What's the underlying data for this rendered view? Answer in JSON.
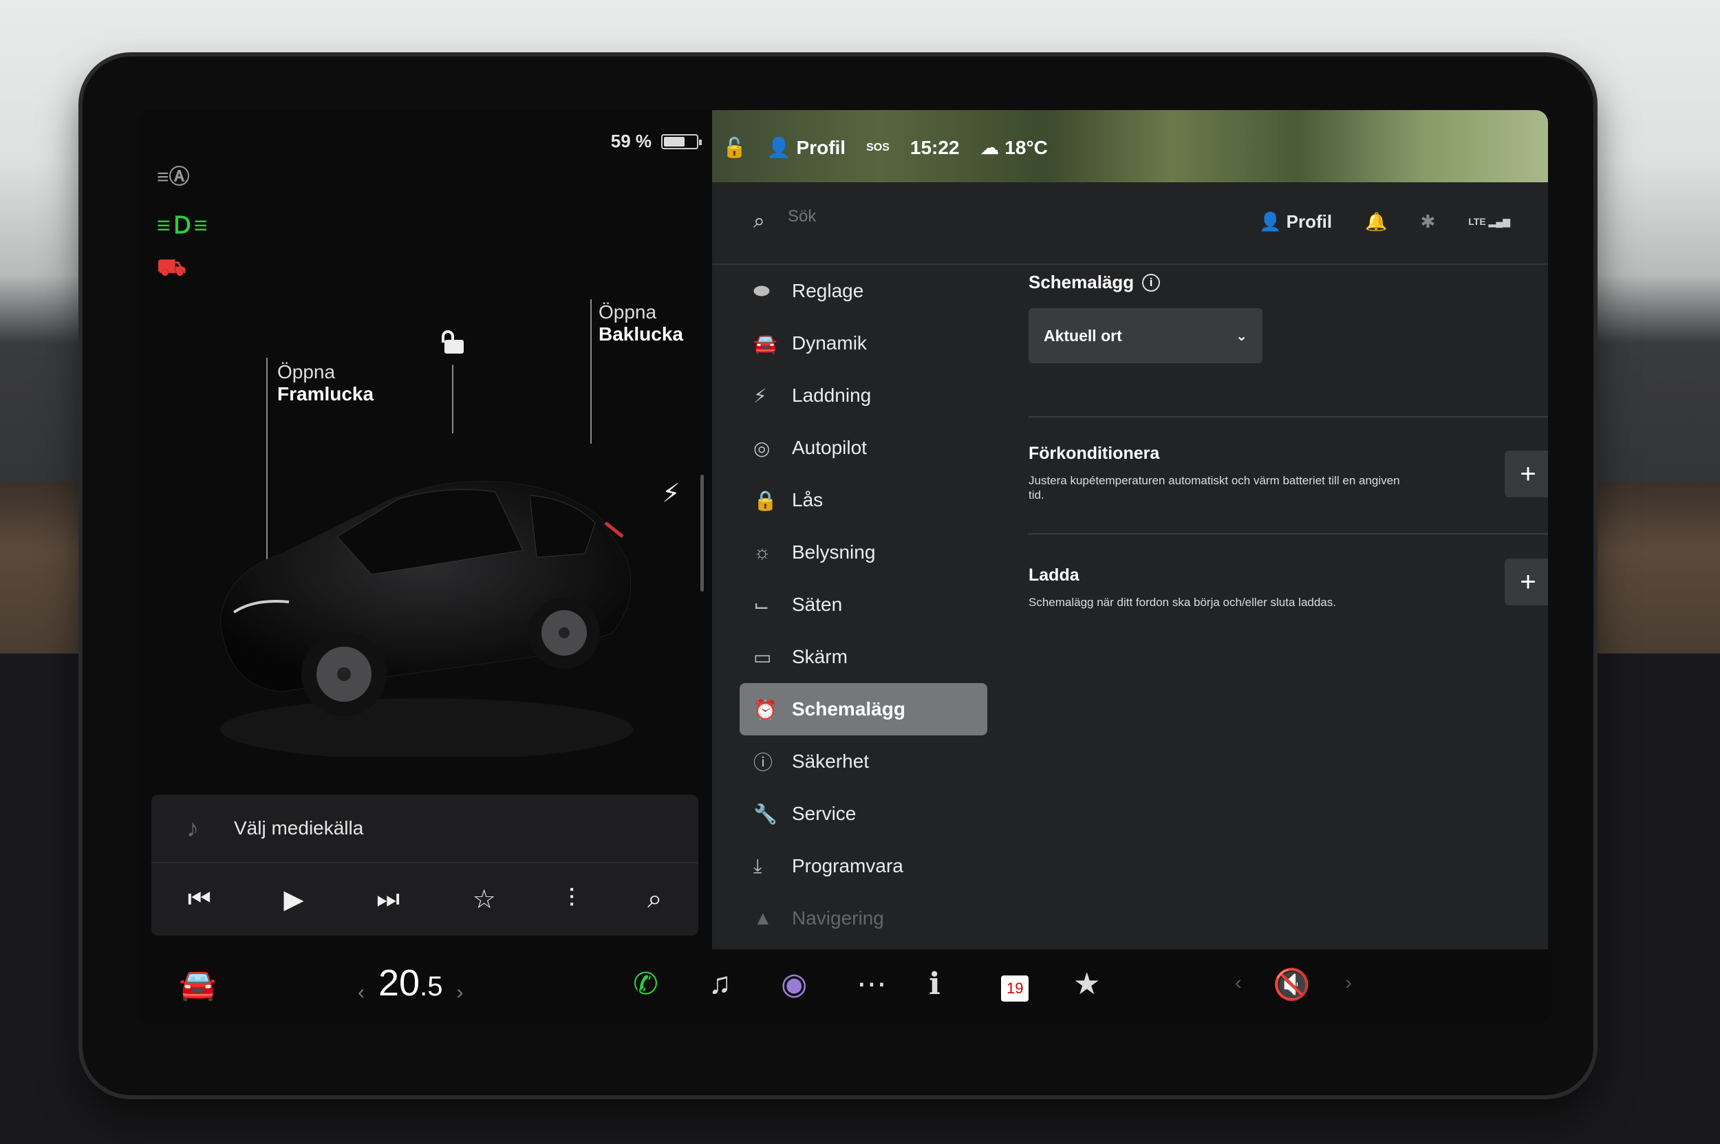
{
  "status": {
    "battery": "59 %",
    "battery_fraction": 0.59,
    "profile": "Profil",
    "sos": "SOS",
    "time": "15:22",
    "weather": "18°C"
  },
  "left_panel": {
    "callout_front_l1": "Öppna",
    "callout_front_l2": "Framlucka",
    "callout_trunk_l1": "Öppna",
    "callout_trunk_l2": "Baklucka"
  },
  "media": {
    "source_label": "Välj mediekälla"
  },
  "search": {
    "placeholder": "Sök"
  },
  "header_right": {
    "profile": "Profil",
    "signal": "LTE"
  },
  "nav": [
    {
      "label": "Reglage",
      "icon": "toggle-icon"
    },
    {
      "label": "Dynamik",
      "icon": "car-icon"
    },
    {
      "label": "Laddning",
      "icon": "bolt-icon"
    },
    {
      "label": "Autopilot",
      "icon": "steering-wheel-icon"
    },
    {
      "label": "Lås",
      "icon": "lock-icon"
    },
    {
      "label": "Belysning",
      "icon": "sun-icon"
    },
    {
      "label": "Säten",
      "icon": "seat-icon"
    },
    {
      "label": "Skärm",
      "icon": "display-icon"
    },
    {
      "label": "Schemalägg",
      "icon": "alarm-clock-icon"
    },
    {
      "label": "Säkerhet",
      "icon": "alert-icon"
    },
    {
      "label": "Service",
      "icon": "wrench-icon"
    },
    {
      "label": "Programvara",
      "icon": "download-icon"
    },
    {
      "label": "Navigering",
      "icon": "navigation-icon"
    }
  ],
  "content": {
    "title": "Schemalägg",
    "dropdown_value": "Aktuell ort",
    "precondition_title": "Förkonditionera",
    "precondition_desc": "Justera kupétemperaturen automatiskt och värm batteriet till en angiven tid.",
    "charge_title": "Ladda",
    "charge_desc": "Schemalägg när ditt fordon ska börja och/eller sluta laddas."
  },
  "bottombar": {
    "temp_int": "20",
    "temp_dec": ".5",
    "calendar_day": "19"
  },
  "colors": {
    "active_nav": "#757779",
    "call_green": "#2ecc40",
    "tell_green": "#2ecc40",
    "tell_red": "#e53935"
  }
}
